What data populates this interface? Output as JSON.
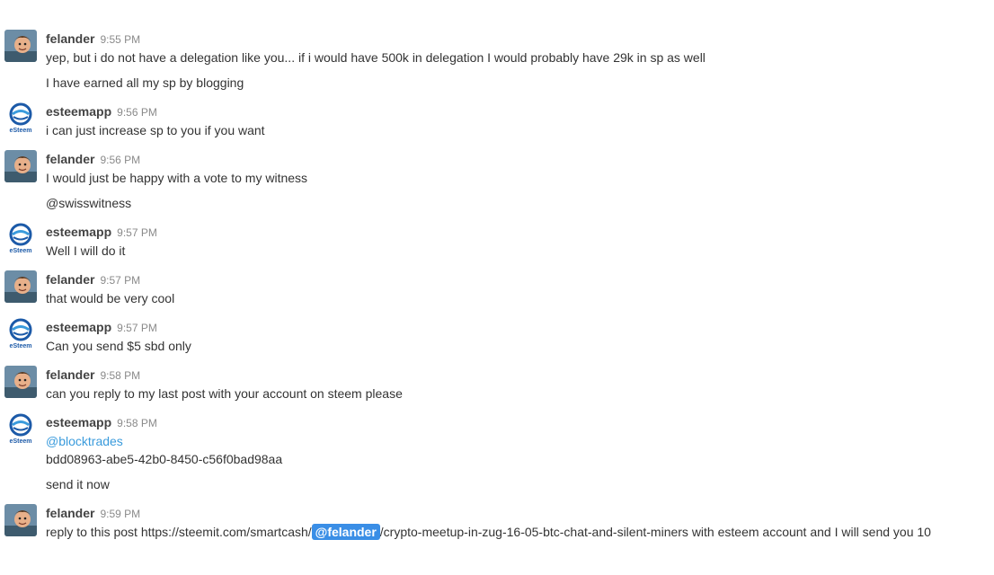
{
  "messages": [
    {
      "user": "felander",
      "time": "9:55 PM",
      "avatar": "felander-avatar",
      "lines": [
        "yep, but i do not have a delegation like you... if i would have 500k in delegation I would probably have 29k in sp as well",
        "I have earned all my sp by blogging"
      ]
    },
    {
      "user": "esteemapp",
      "time": "9:56 PM",
      "avatar": "esteem-logo",
      "lines": [
        "i can just increase sp to you if you want"
      ]
    },
    {
      "user": "felander",
      "time": "9:56 PM",
      "avatar": "felander-avatar",
      "lines": [
        "I would just be happy with a vote to my witness",
        "@swisswitness"
      ]
    },
    {
      "user": "esteemapp",
      "time": "9:57 PM",
      "avatar": "esteem-logo",
      "lines": [
        "Well I will do it"
      ]
    },
    {
      "user": "felander",
      "time": "9:57 PM",
      "avatar": "felander-avatar",
      "lines": [
        "that would be very cool"
      ]
    },
    {
      "user": "esteemapp",
      "time": "9:57 PM",
      "avatar": "esteem-logo",
      "lines": [
        "Can you send $5 sbd only"
      ]
    },
    {
      "user": "felander",
      "time": "9:58 PM",
      "avatar": "felander-avatar",
      "lines": [
        "can you reply to my last post with your account on steem please"
      ]
    },
    {
      "user": "esteemapp",
      "time": "9:58 PM",
      "avatar": "esteem-logo",
      "lines": [
        "@blocktrades",
        "bdd08963-abe5-42b0-8450-c56f0bad98aa",
        "send it now"
      ]
    },
    {
      "user": "felander",
      "time": "9:59 PM",
      "avatar": "felander-avatar",
      "last_prefix": "reply to this post https://steemit.com/smartcash/",
      "last_mention": "@felander",
      "last_suffix": "/crypto-meetup-in-zug-16-05-btc-chat-and-silent-miners with esteem account and I will send you 10"
    }
  ],
  "logo_text": "eSteem",
  "colors": {
    "link": "#3a9bdc",
    "mention_pill": "#3a8ee6",
    "username": "#444444",
    "timestamp": "#8a8a8a"
  }
}
